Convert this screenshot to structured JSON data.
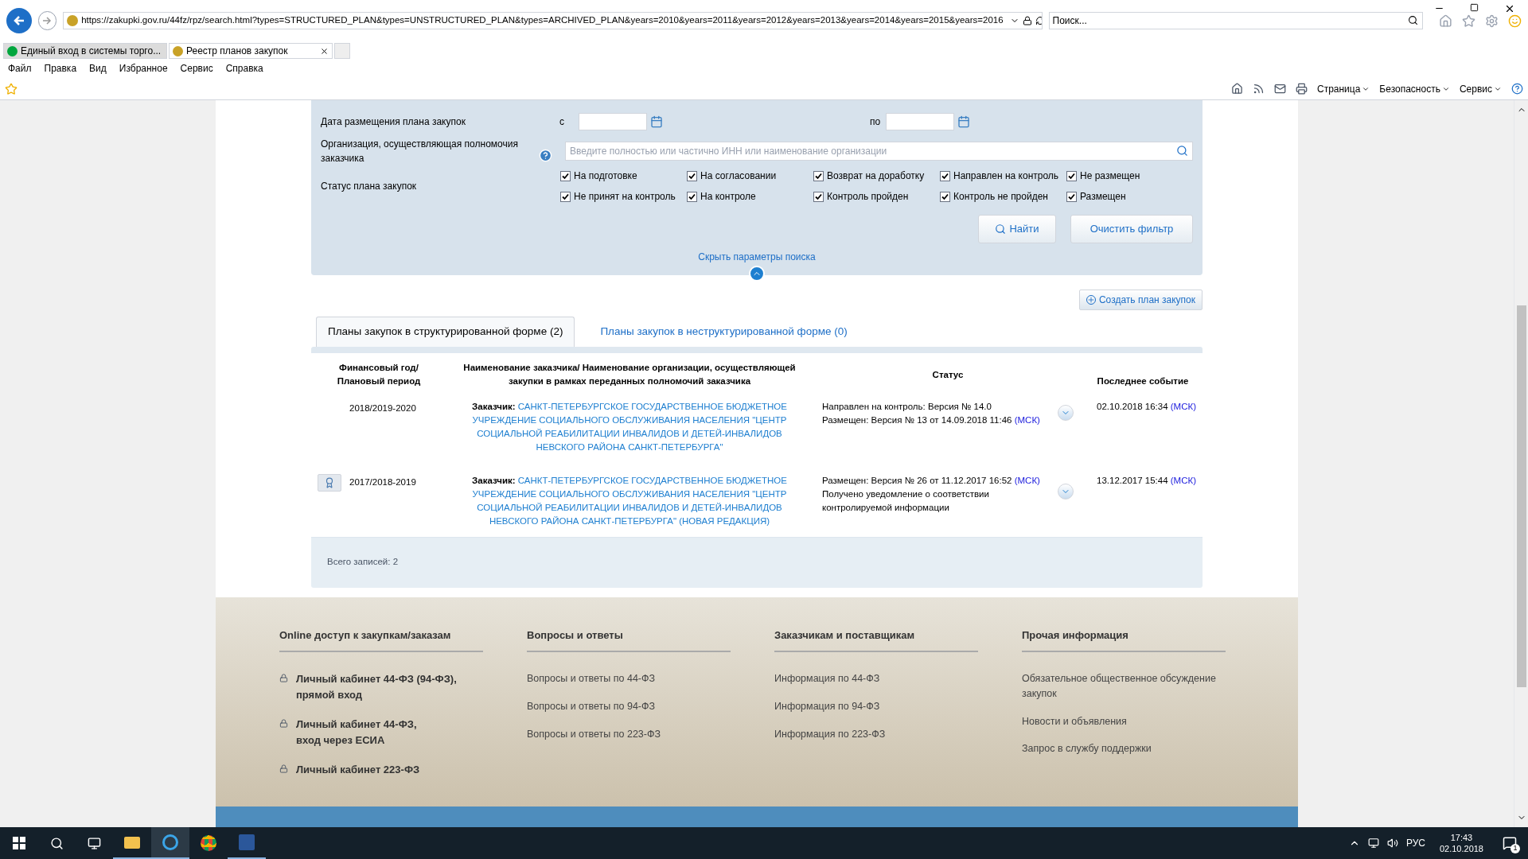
{
  "browser": {
    "address": "https://zakupki.gov.ru/44fz/rpz/search.html?types=STRUCTURED_PLAN&types=UNSTRUCTURED_PLAN&types=ARCHIVED_PLAN&years=2010&years=2011&years=2012&years=2013&years=2014&years=2015&years=2016",
    "search_placeholder": "Поиск...",
    "tabs": [
      {
        "label": "Единый вход в системы торго...",
        "selected": false
      },
      {
        "label": "Реестр планов закупок",
        "selected": true
      }
    ],
    "menu": [
      "Файл",
      "Правка",
      "Вид",
      "Избранное",
      "Сервис",
      "Справка"
    ],
    "commands": [
      "Страница",
      "Безопасность",
      "Сервис"
    ]
  },
  "form": {
    "date_label": "Дата размещения плана закупок",
    "from_label": "с",
    "to_label": "по",
    "org_label": "Организация, осуществляющая полномочия заказчика",
    "org_placeholder": "Введите полностью или частично ИНН или наименование организации",
    "status_label": "Статус плана закупок",
    "statuses": [
      {
        "label": "На подготовке",
        "checked": true
      },
      {
        "label": "На согласовании",
        "checked": true
      },
      {
        "label": "Возврат на доработку",
        "checked": true
      },
      {
        "label": "Направлен на контроль",
        "checked": true
      },
      {
        "label": "Не размещен",
        "checked": true
      },
      {
        "label": "Не принят на контроль",
        "checked": true
      },
      {
        "label": "На контроле",
        "checked": true
      },
      {
        "label": "Контроль пройден",
        "checked": true
      },
      {
        "label": "Контроль не пройден",
        "checked": true
      },
      {
        "label": "Размещен",
        "checked": true
      }
    ],
    "find_button": "Найти",
    "clear_button": "Очистить фильтр",
    "hide_link": "Скрыть параметры поиска"
  },
  "create_button": "Создать план закупок",
  "plan_tabs": [
    {
      "label": "Планы закупок в структурированной форме (2)",
      "selected": true
    },
    {
      "label": "Планы закупок в неструктурированной форме (0)",
      "selected": false
    }
  ],
  "table": {
    "columns": [
      "Финансовый год/ Плановый период",
      "Наименование заказчика/ Наименование организации, осуществляющей закупки в рамках переданных полномочий заказчика",
      "Статус",
      "Последнее событие"
    ],
    "rows": [
      {
        "badge": false,
        "year": "2018/2019-2020",
        "customer_label": "Заказчик:",
        "customer_name": "САНКТ-ПЕТЕРБУРГСКОЕ ГОСУДАРСТВЕННОЕ БЮДЖЕТНОЕ УЧРЕЖДЕНИЕ СОЦИАЛЬНОГО ОБСЛУЖИВАНИЯ НАСЕЛЕНИЯ \"ЦЕНТР СОЦИАЛЬНОЙ РЕАБИЛИТАЦИИ ИНВАЛИДОВ И ДЕТЕЙ-ИНВАЛИДОВ НЕВСКОГО РАЙОНА САНКТ-ПЕТЕРБУРГА\"",
        "status_lines": [
          {
            "text": "Направлен на контроль: Версия № 14.0"
          },
          {
            "text": "Размещен: Версия № 13 от 14.09.2018 11:46",
            "tz": "(МСК)"
          }
        ],
        "last_event": "02.10.2018 16:34",
        "last_tz": "(МСК)"
      },
      {
        "badge": true,
        "year": "2017/2018-2019",
        "customer_label": "Заказчик:",
        "customer_name": "САНКТ-ПЕТЕРБУРГСКОЕ ГОСУДАРСТВЕННОЕ БЮДЖЕТНОЕ УЧРЕЖДЕНИЕ СОЦИАЛЬНОГО ОБСЛУЖИВАНИЯ НАСЕЛЕНИЯ \"ЦЕНТР СОЦИАЛЬНОЙ РЕАБИЛИТАЦИИ ИНВАЛИДОВ И ДЕТЕЙ-ИНВАЛИДОВ НЕВСКОГО РАЙОНА САНКТ-ПЕТЕРБУРГА\" (НОВАЯ РЕДАКЦИЯ)",
        "status_lines": [
          {
            "text": "Размещен: Версия № 26 от 11.12.2017 16:52",
            "tz": "(МСК)"
          },
          {
            "text": "Получено уведомление о соответствии контролируемой информации"
          }
        ],
        "last_event": "13.12.2017 15:44",
        "last_tz": "(МСК)"
      }
    ],
    "total": "Всего записей: 2"
  },
  "footer": [
    {
      "title": "Online доступ к закупкам/заказам",
      "kind": "cabinet",
      "items": [
        [
          "Личный кабинет 44-ФЗ (94-ФЗ),",
          "прямой вход"
        ],
        [
          "Личный кабинет 44-ФЗ,",
          "вход через ЕСИА"
        ],
        [
          "Личный кабинет 223-ФЗ"
        ]
      ]
    },
    {
      "title": "Вопросы и ответы",
      "kind": "links",
      "items": [
        [
          "Вопросы и ответы по 44-ФЗ"
        ],
        [
          "Вопросы и ответы по 94-ФЗ"
        ],
        [
          "Вопросы и ответы по 223-ФЗ"
        ]
      ]
    },
    {
      "title": "Заказчикам и поставщикам",
      "kind": "links",
      "items": [
        [
          "Информация по 44-ФЗ"
        ],
        [
          "Информация по 94-ФЗ"
        ],
        [
          "Информация по 223-ФЗ"
        ]
      ]
    },
    {
      "title": "Прочая информация",
      "kind": "links",
      "items": [
        [
          "Обязательное общественное обсуждение закупок"
        ],
        [
          "Новости и объявления"
        ],
        [
          "Запрос в службу поддержки"
        ]
      ]
    }
  ],
  "taskbar": {
    "language": "РУС",
    "time": "17:43",
    "date": "02.10.2018",
    "notifications": "1"
  }
}
